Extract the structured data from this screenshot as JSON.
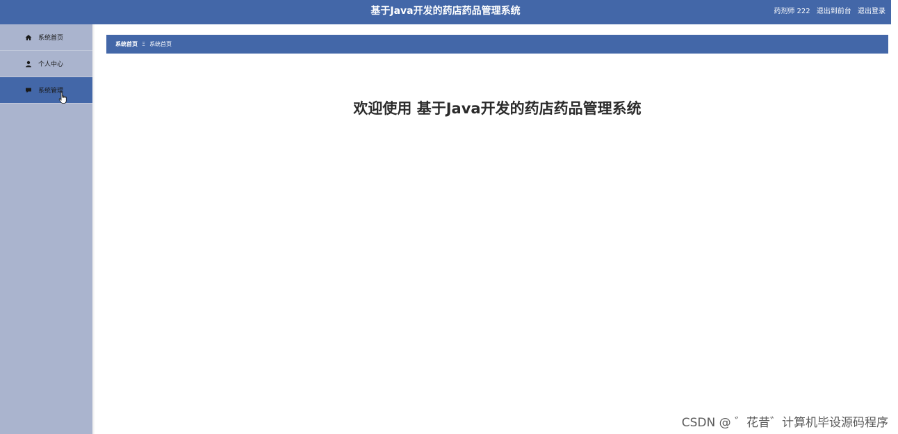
{
  "header": {
    "title": "基于Java开发的药店药品管理系统",
    "user_label": "药剂师 222",
    "exit_front_label": "退出到前台",
    "logout_label": "退出登录"
  },
  "sidebar": {
    "items": [
      {
        "label": "系统首页",
        "icon": "home-icon",
        "active": false
      },
      {
        "label": "个人中心",
        "icon": "user-icon",
        "active": false
      },
      {
        "label": "系统管理",
        "icon": "chat-icon",
        "active": true
      }
    ]
  },
  "breadcrumb": {
    "home": "系统首页",
    "separator": "Ξ",
    "current": "系统首页"
  },
  "main": {
    "welcome": "欢迎使用 基于Java开发的药店药品管理系统"
  },
  "watermark": "CSDN @ ゛花昔゛计算机毕设源码程序",
  "colors": {
    "header_bg": "#4367a8",
    "sidebar_bg": "#aab4ce",
    "active_item_bg": "#4367a8"
  }
}
